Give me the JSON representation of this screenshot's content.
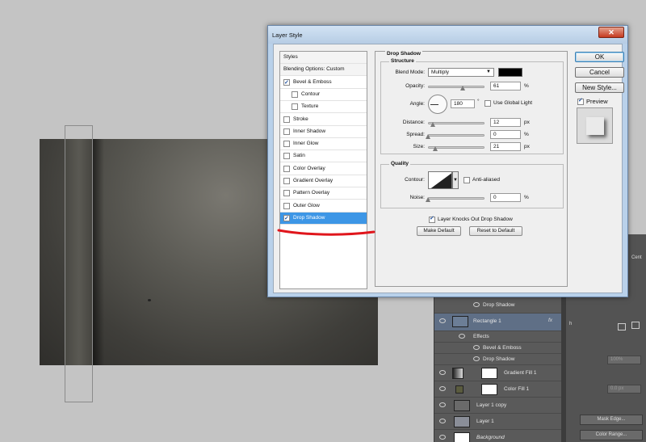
{
  "dialog": {
    "title": "Layer Style",
    "close_glyph": "✕",
    "styles_list": [
      {
        "label": "Styles",
        "type": "header"
      },
      {
        "label": "Blending Options: Custom",
        "type": "header"
      },
      {
        "label": "Bevel & Emboss",
        "checked": true,
        "indent": 0
      },
      {
        "label": "Contour",
        "checked": false,
        "indent": 1
      },
      {
        "label": "Texture",
        "checked": false,
        "indent": 1
      },
      {
        "label": "Stroke",
        "checked": false,
        "indent": 0
      },
      {
        "label": "Inner Shadow",
        "checked": false,
        "indent": 0
      },
      {
        "label": "Inner Glow",
        "checked": false,
        "indent": 0
      },
      {
        "label": "Satin",
        "checked": false,
        "indent": 0
      },
      {
        "label": "Color Overlay",
        "checked": false,
        "indent": 0
      },
      {
        "label": "Gradient Overlay",
        "checked": false,
        "indent": 0
      },
      {
        "label": "Pattern Overlay",
        "checked": false,
        "indent": 0
      },
      {
        "label": "Outer Glow",
        "checked": false,
        "indent": 0
      },
      {
        "label": "Drop Shadow",
        "checked": true,
        "indent": 0,
        "selected": true
      }
    ],
    "drop_shadow": {
      "section_title": "Drop Shadow",
      "structure_title": "Structure",
      "blend_mode_label": "Blend Mode:",
      "blend_mode_value": "Multiply",
      "shadow_color": "#000000",
      "opacity_label": "Opacity:",
      "opacity_value": "61",
      "opacity_unit": "%",
      "opacity_fraction": 0.61,
      "angle_label": "Angle:",
      "angle_value": "180",
      "angle_unit": "°",
      "use_global_light_label": "Use Global Light",
      "use_global_light": false,
      "distance_label": "Distance:",
      "distance_value": "12",
      "distance_unit": "px",
      "spread_label": "Spread:",
      "spread_value": "0",
      "spread_unit": "%",
      "size_label": "Size:",
      "size_value": "21",
      "size_unit": "px",
      "quality_title": "Quality",
      "contour_label": "Contour:",
      "anti_aliased_label": "Anti-aliased",
      "anti_aliased": false,
      "noise_label": "Noise:",
      "noise_value": "0",
      "noise_unit": "%",
      "knockout_label": "Layer Knocks Out Drop Shadow",
      "knockout": true,
      "make_default_label": "Make Default",
      "reset_default_label": "Reset to Default"
    },
    "buttons": {
      "ok": "OK",
      "cancel": "Cancel",
      "new_style": "New Style...",
      "preview_label": "Preview",
      "preview_checked": true
    }
  },
  "layers": [
    {
      "label": "Drop Shadow",
      "type": "effect"
    },
    {
      "label": "Rectangle 1",
      "type": "layer",
      "selected": true,
      "fx": "fx"
    },
    {
      "label": "Effects",
      "type": "effects-header"
    },
    {
      "label": "Bevel & Emboss",
      "type": "effect"
    },
    {
      "label": "Drop Shadow",
      "type": "effect"
    },
    {
      "label": "Gradient Fill 1",
      "type": "fill"
    },
    {
      "label": "Color Fill 1",
      "type": "fill"
    },
    {
      "label": "Layer 1 copy",
      "type": "layer"
    },
    {
      "label": "Layer 1",
      "type": "layer"
    },
    {
      "label": "Background",
      "type": "layer"
    }
  ],
  "right_panel": {
    "partial_label": "Cent",
    "partial_h": "h",
    "density": "100%",
    "feather": "0.0 px",
    "mask_edge": "Mask Edge...",
    "color_range": "Color Range..."
  },
  "colors": {
    "selection_blue": "#3d96e6",
    "annotation_red": "#e0161c"
  }
}
